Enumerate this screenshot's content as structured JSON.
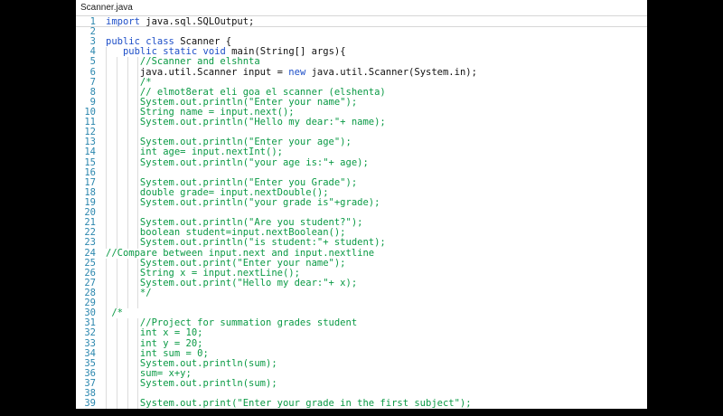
{
  "editor": {
    "tab_label": "Scanner.java",
    "colors": {
      "keyword": "#1e4fc8",
      "comment": "#0a9a45",
      "plain": "#111111",
      "lineNumber": "#2b87ae",
      "guide": "#dcdcdc",
      "separator": "#d6d6d6"
    },
    "lines": [
      {
        "n": 1,
        "u": true,
        "g": [],
        "s": [
          [
            "k",
            "import"
          ],
          [
            "p",
            " java.sql.SQLOutput;"
          ]
        ]
      },
      {
        "n": 2,
        "g": [],
        "s": []
      },
      {
        "n": 3,
        "g": [],
        "s": [
          [
            "k",
            "public"
          ],
          [
            "p",
            " "
          ],
          [
            "k",
            "class"
          ],
          [
            "p",
            " Scanner {"
          ]
        ]
      },
      {
        "n": 4,
        "g": [
          0
        ],
        "s": [
          [
            "p",
            "   "
          ],
          [
            "k",
            "public"
          ],
          [
            "p",
            " "
          ],
          [
            "k",
            "static"
          ],
          [
            "p",
            " "
          ],
          [
            "k",
            "void"
          ],
          [
            "p",
            " main(String[] args){"
          ]
        ]
      },
      {
        "n": 5,
        "g": [
          0,
          12,
          24,
          35
        ],
        "s": [
          [
            "c",
            "      //Scanner and elshnta"
          ]
        ]
      },
      {
        "n": 6,
        "g": [
          0,
          12,
          24,
          35
        ],
        "s": [
          [
            "p",
            "      java.util.Scanner input = "
          ],
          [
            "k",
            "new"
          ],
          [
            "p",
            " java.util.Scanner(System.in);"
          ]
        ]
      },
      {
        "n": 7,
        "g": [
          0,
          12,
          24,
          35
        ],
        "s": [
          [
            "c",
            "      /*"
          ]
        ]
      },
      {
        "n": 8,
        "g": [
          0,
          12,
          24,
          35
        ],
        "s": [
          [
            "c",
            "      // elmot8erat eli goa el scanner (elshenta)"
          ]
        ]
      },
      {
        "n": 9,
        "g": [
          0,
          12,
          24,
          35
        ],
        "s": [
          [
            "c",
            "      System.out.println(\"Enter your name\");"
          ]
        ]
      },
      {
        "n": 10,
        "g": [
          0,
          12,
          24,
          35
        ],
        "s": [
          [
            "c",
            "      String name = input.next();"
          ]
        ]
      },
      {
        "n": 11,
        "g": [
          0,
          12,
          24,
          35
        ],
        "s": [
          [
            "c",
            "      System.out.println(\"Hello my dear:\"+ name);"
          ]
        ]
      },
      {
        "n": 12,
        "g": [
          0,
          12,
          24,
          35
        ],
        "s": []
      },
      {
        "n": 13,
        "g": [
          0,
          12,
          24,
          35
        ],
        "s": [
          [
            "c",
            "      System.out.println(\"Enter your age\");"
          ]
        ]
      },
      {
        "n": 14,
        "g": [
          0,
          12,
          24,
          35
        ],
        "s": [
          [
            "c",
            "      int age= input.nextInt();"
          ]
        ]
      },
      {
        "n": 15,
        "g": [
          0,
          12,
          24,
          35
        ],
        "s": [
          [
            "c",
            "      System.out.println(\"your age is:\"+ age);"
          ]
        ]
      },
      {
        "n": 16,
        "g": [
          0,
          12,
          24,
          35
        ],
        "s": []
      },
      {
        "n": 17,
        "g": [
          0,
          12,
          24,
          35
        ],
        "s": [
          [
            "c",
            "      System.out.println(\"Enter you Grade\");"
          ]
        ]
      },
      {
        "n": 18,
        "g": [
          0,
          12,
          24,
          35
        ],
        "s": [
          [
            "c",
            "      double grade= input.nextDouble();"
          ]
        ]
      },
      {
        "n": 19,
        "g": [
          0,
          12,
          24,
          35
        ],
        "s": [
          [
            "c",
            "      System.out.println(\"your grade is\"+grade);"
          ]
        ]
      },
      {
        "n": 20,
        "g": [
          0,
          12,
          24,
          35
        ],
        "s": []
      },
      {
        "n": 21,
        "g": [
          0,
          12,
          24,
          35
        ],
        "s": [
          [
            "c",
            "      System.out.println(\"Are you student?\");"
          ]
        ]
      },
      {
        "n": 22,
        "g": [
          0,
          12,
          24,
          35
        ],
        "s": [
          [
            "c",
            "      boolean student=input.nextBoolean();"
          ]
        ]
      },
      {
        "n": 23,
        "g": [
          0,
          12,
          24,
          35
        ],
        "s": [
          [
            "c",
            "      System.out.println(\"is student:\"+ student);"
          ]
        ]
      },
      {
        "n": 24,
        "g": [],
        "s": [
          [
            "c",
            "//Compare between input.next and input.nextline"
          ]
        ]
      },
      {
        "n": 25,
        "g": [
          0,
          12,
          24,
          35
        ],
        "s": [
          [
            "c",
            "      System.out.print(\"Enter your name\");"
          ]
        ]
      },
      {
        "n": 26,
        "g": [
          0,
          12,
          24,
          35
        ],
        "s": [
          [
            "c",
            "      String x = input.nextLine();"
          ]
        ]
      },
      {
        "n": 27,
        "g": [
          0,
          12,
          24,
          35
        ],
        "s": [
          [
            "c",
            "      System.out.print(\"Hello my dear:\"+ x);"
          ]
        ]
      },
      {
        "n": 28,
        "g": [
          0,
          12,
          24,
          35
        ],
        "s": [
          [
            "c",
            "      */"
          ]
        ]
      },
      {
        "n": 29,
        "g": [
          0,
          12,
          24,
          35
        ],
        "s": []
      },
      {
        "n": 30,
        "g": [
          0
        ],
        "s": [
          [
            "c",
            " /*"
          ]
        ]
      },
      {
        "n": 31,
        "g": [
          0,
          12,
          24,
          35
        ],
        "s": [
          [
            "c",
            "      //Project for summation grades student"
          ]
        ]
      },
      {
        "n": 32,
        "g": [
          0,
          12,
          24,
          35
        ],
        "s": [
          [
            "c",
            "      int x = 10;"
          ]
        ]
      },
      {
        "n": 33,
        "g": [
          0,
          12,
          24,
          35
        ],
        "s": [
          [
            "c",
            "      int y = 20;"
          ]
        ]
      },
      {
        "n": 34,
        "g": [
          0,
          12,
          24,
          35
        ],
        "s": [
          [
            "c",
            "      int sum = 0;"
          ]
        ]
      },
      {
        "n": 35,
        "g": [
          0,
          12,
          24,
          35
        ],
        "s": [
          [
            "c",
            "      System.out.println(sum);"
          ]
        ]
      },
      {
        "n": 36,
        "g": [
          0,
          12,
          24,
          35
        ],
        "s": [
          [
            "c",
            "      sum= x+y;"
          ]
        ]
      },
      {
        "n": 37,
        "g": [
          0,
          12,
          24,
          35
        ],
        "s": [
          [
            "c",
            "      System.out.println(sum);"
          ]
        ]
      },
      {
        "n": 38,
        "g": [
          0,
          12,
          24,
          35
        ],
        "s": []
      },
      {
        "n": 39,
        "g": [
          0,
          12,
          24,
          35
        ],
        "s": [
          [
            "c",
            "      System.out.print(\"Enter your grade in the first subject\");"
          ]
        ]
      }
    ]
  }
}
